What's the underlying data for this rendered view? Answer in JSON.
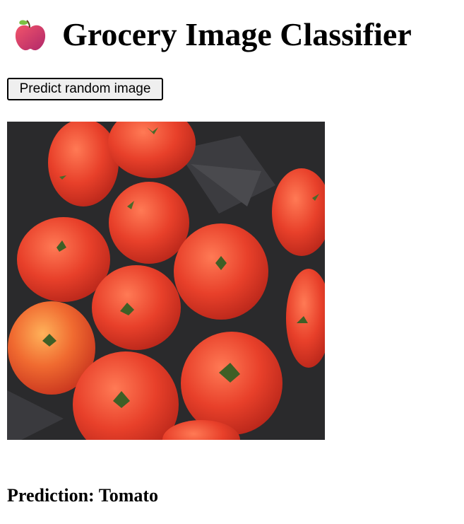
{
  "header": {
    "icon": "red-apple-icon",
    "title": "Grocery Image Classifier"
  },
  "controls": {
    "predict_label": "Predict random image"
  },
  "image": {
    "subject": "tomatoes",
    "icon": "tomatoes-photo"
  },
  "result": {
    "prediction_text": "Prediction: Tomato"
  },
  "colors": {
    "apple": "#e0344f",
    "tomato": "#e8402a",
    "background_tray": "#2a2a2c"
  }
}
